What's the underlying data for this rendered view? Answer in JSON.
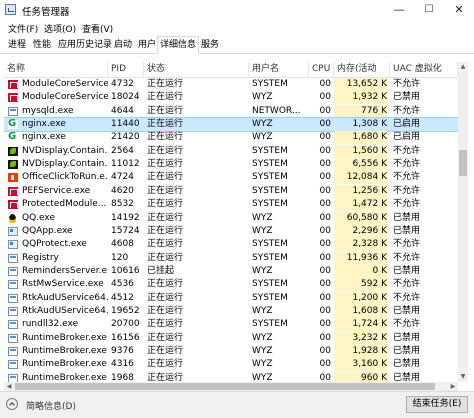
{
  "window": {
    "title": "任务管理器",
    "minimize": "—",
    "maximize": "☐",
    "close": "✕"
  },
  "menu": [
    "文件(F)",
    "选项(O)",
    "查看(V)"
  ],
  "tabs": [
    "进程",
    "性能",
    "应用历史记录",
    "启动",
    "用户",
    "详细信息",
    "服务"
  ],
  "active_tab": 5,
  "columns": [
    "名称",
    "PID",
    "状态",
    "用户名",
    "CPU",
    "内存(活动的...",
    "UAC 虚拟化"
  ],
  "rows": [
    {
      "icon": "mcafee-icon",
      "name": "ModuleCoreService...",
      "pid": "4732",
      "status": "正在运行",
      "user": "SYSTEM",
      "cpu": "00",
      "mem": "13,652 K",
      "uac": "不允许"
    },
    {
      "icon": "mcafee-icon",
      "name": "ModuleCoreService...",
      "pid": "18024",
      "status": "正在运行",
      "user": "WYZ",
      "cpu": "00",
      "mem": "1,932 K",
      "uac": "已禁用"
    },
    {
      "icon": "window-app-icon",
      "name": "mysqld.exe",
      "pid": "4644",
      "status": "正在运行",
      "user": "NETWOR...",
      "cpu": "00",
      "mem": "776 K",
      "uac": "不允许"
    },
    {
      "icon": "nginx-icon",
      "name": "nginx.exe",
      "pid": "11440",
      "status": "正在运行",
      "user": "WYZ",
      "cpu": "00",
      "mem": "1,308 K",
      "uac": "已启用",
      "selected": true
    },
    {
      "icon": "nginx-icon",
      "name": "nginx.exe",
      "pid": "21420",
      "status": "正在运行",
      "user": "WYZ",
      "cpu": "00",
      "mem": "1,680 K",
      "uac": "已启用"
    },
    {
      "icon": "nvidia-icon",
      "name": "NVDisplay.Contain...",
      "pid": "2564",
      "status": "正在运行",
      "user": "SYSTEM",
      "cpu": "00",
      "mem": "1,560 K",
      "uac": "不允许"
    },
    {
      "icon": "nvidia-icon",
      "name": "NVDisplay.Contain...",
      "pid": "11012",
      "status": "正在运行",
      "user": "SYSTEM",
      "cpu": "00",
      "mem": "6,556 K",
      "uac": "不允许"
    },
    {
      "icon": "office-icon",
      "name": "OfficeClickToRun.e...",
      "pid": "4724",
      "status": "正在运行",
      "user": "SYSTEM",
      "cpu": "00",
      "mem": "12,084 K",
      "uac": "不允许"
    },
    {
      "icon": "mcafee-icon",
      "name": "PEFService.exe",
      "pid": "4620",
      "status": "正在运行",
      "user": "SYSTEM",
      "cpu": "00",
      "mem": "1,256 K",
      "uac": "不允许"
    },
    {
      "icon": "mcafee-icon",
      "name": "ProtectedModule...",
      "pid": "8532",
      "status": "正在运行",
      "user": "SYSTEM",
      "cpu": "00",
      "mem": "1,472 K",
      "uac": "不允许"
    },
    {
      "icon": "qq-icon",
      "name": "QQ.exe",
      "pid": "14192",
      "status": "正在运行",
      "user": "WYZ",
      "cpu": "00",
      "mem": "60,580 K",
      "uac": "已禁用"
    },
    {
      "icon": "qq-app-icon",
      "name": "QQApp.exe",
      "pid": "15724",
      "status": "正在运行",
      "user": "WYZ",
      "cpu": "00",
      "mem": "2,296 K",
      "uac": "已禁用"
    },
    {
      "icon": "qq-app-icon",
      "name": "QQProtect.exe",
      "pid": "4608",
      "status": "正在运行",
      "user": "SYSTEM",
      "cpu": "00",
      "mem": "2,328 K",
      "uac": "不允许"
    },
    {
      "icon": "window-app-icon",
      "name": "Registry",
      "pid": "120",
      "status": "正在运行",
      "user": "SYSTEM",
      "cpu": "00",
      "mem": "11,936 K",
      "uac": "不允许"
    },
    {
      "icon": "window-app-icon",
      "name": "RemindersServer.e...",
      "pid": "10616",
      "status": "已挂起",
      "user": "WYZ",
      "cpu": "00",
      "mem": "0 K",
      "uac": "已禁用"
    },
    {
      "icon": "window-app-icon",
      "name": "RstMwService.exe",
      "pid": "4536",
      "status": "正在运行",
      "user": "SYSTEM",
      "cpu": "00",
      "mem": "592 K",
      "uac": "不允许"
    },
    {
      "icon": "window-app-icon",
      "name": "RtkAudUService64...",
      "pid": "4512",
      "status": "正在运行",
      "user": "SYSTEM",
      "cpu": "00",
      "mem": "1,200 K",
      "uac": "不允许"
    },
    {
      "icon": "window-app-icon",
      "name": "RtkAudUService64...",
      "pid": "19652",
      "status": "正在运行",
      "user": "WYZ",
      "cpu": "00",
      "mem": "1,608 K",
      "uac": "已禁用"
    },
    {
      "icon": "window-app-icon",
      "name": "rundll32.exe",
      "pid": "20700",
      "status": "正在运行",
      "user": "SYSTEM",
      "cpu": "00",
      "mem": "1,724 K",
      "uac": "不允许"
    },
    {
      "icon": "window-app-icon",
      "name": "RuntimeBroker.exe",
      "pid": "16156",
      "status": "正在运行",
      "user": "WYZ",
      "cpu": "00",
      "mem": "3,232 K",
      "uac": "已禁用"
    },
    {
      "icon": "window-app-icon",
      "name": "RuntimeBroker.exe",
      "pid": "9376",
      "status": "正在运行",
      "user": "WYZ",
      "cpu": "00",
      "mem": "1,928 K",
      "uac": "已禁用"
    },
    {
      "icon": "window-app-icon",
      "name": "RuntimeBroker.exe",
      "pid": "4316",
      "status": "正在运行",
      "user": "WYZ",
      "cpu": "00",
      "mem": "3,160 K",
      "uac": "已禁用"
    },
    {
      "icon": "window-app-icon",
      "name": "RuntimeBroker.exe",
      "pid": "1968",
      "status": "正在运行",
      "user": "WYZ",
      "cpu": "00",
      "mem": "960 K",
      "uac": "已禁用"
    }
  ],
  "footer": {
    "less_details": "简略信息(D)",
    "end_task": "结束任务(E)"
  }
}
